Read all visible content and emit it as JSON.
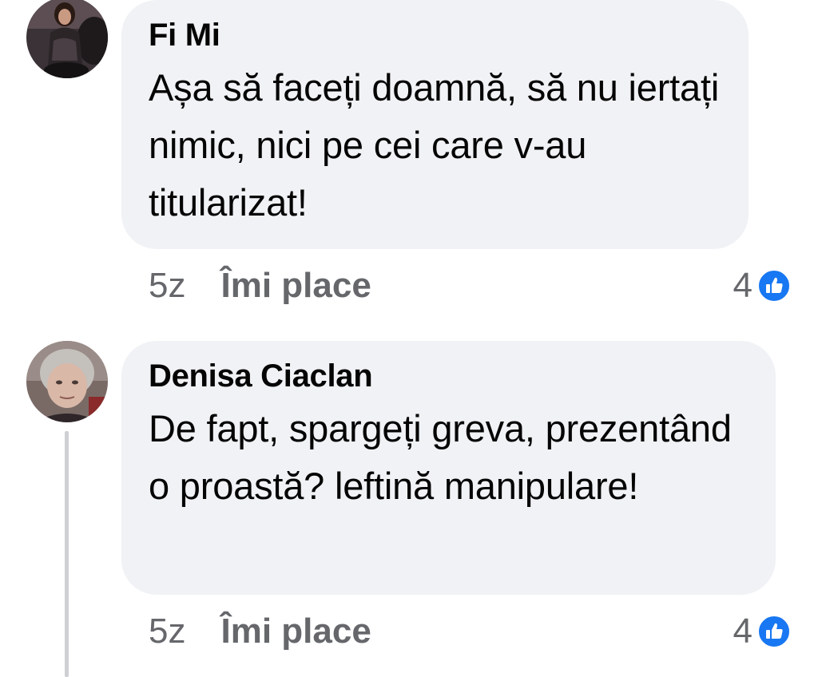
{
  "comments": [
    {
      "author": "Fi Mi",
      "text": "Așa să faceți doamnă, să nu iertați nimic, nici pe cei care v-au titularizat!",
      "time": "5z",
      "like_label": "Îmi place",
      "reaction_count": "4",
      "reaction_icon": "like-icon"
    },
    {
      "author": "Denisa Ciaclan",
      "text": "De fapt, spargeți greva, prezentând o proastă? leftină manipulare!",
      "time": "5z",
      "like_label": "Îmi place",
      "reaction_count": "4",
      "reaction_icon": "like-icon"
    }
  ],
  "colors": {
    "bubble": "#f0f2f5",
    "meta_text": "#65676b",
    "like_blue": "#1877f2",
    "thread_line": "#ced0d4"
  }
}
